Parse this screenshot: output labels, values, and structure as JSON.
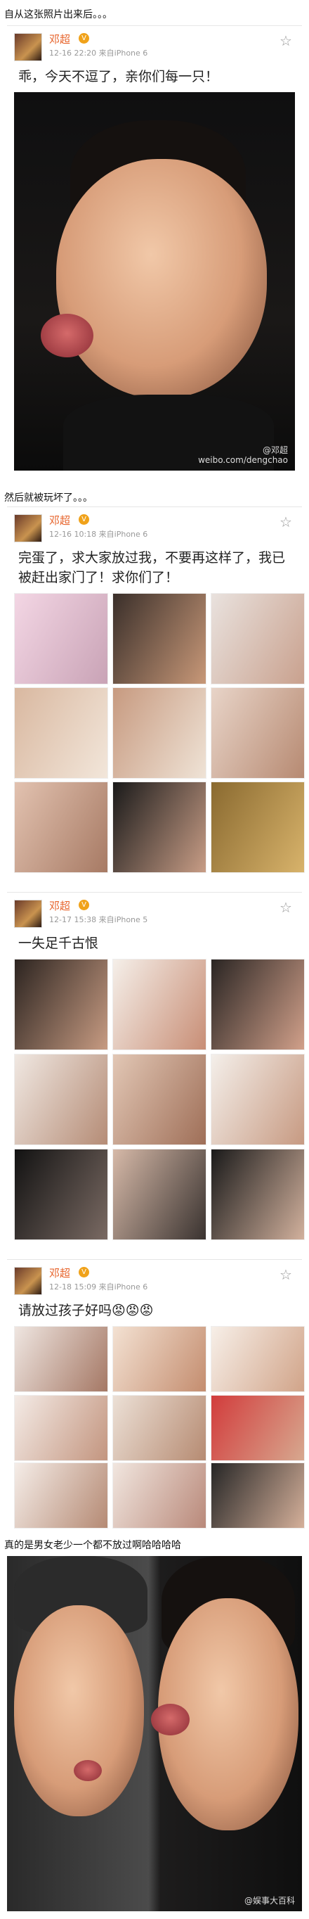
{
  "captions": {
    "first": "自从这张照片出来后。。。",
    "second": "然后就被玩坏了。。。",
    "last": "真的是男女老少一个都不放过啊哈哈哈哈"
  },
  "posts": [
    {
      "user": "邓超",
      "meta": "12-16 22:20  来自iPhone 6",
      "text": "乖，今天不逗了，亲你们每一只！",
      "watermark_line1": "@邓超",
      "watermark_line2": "weibo.com/dengchao"
    },
    {
      "user": "邓超",
      "meta": "12-16 10:18  来自iPhone 6",
      "text": "完蛋了，求大家放过我，不要再这样了，我已被赶出家门了！求你们了！"
    },
    {
      "user": "邓超",
      "meta": "12-17 15:38  来自iPhone 5",
      "text": "一失足千古恨"
    },
    {
      "user": "邓超",
      "meta": "12-18 15:09  来自iPhone 6",
      "text": "请放过孩子好吗😡😡😡"
    }
  ],
  "final_photo": {
    "watermark": "@娱事大百科"
  },
  "icons": {
    "avatar": "avatar",
    "vip": "vip-badge-icon",
    "star": "star-icon"
  },
  "colors": {
    "username": "#e7642c",
    "meta": "#999999",
    "vip": "#f0a21a"
  }
}
